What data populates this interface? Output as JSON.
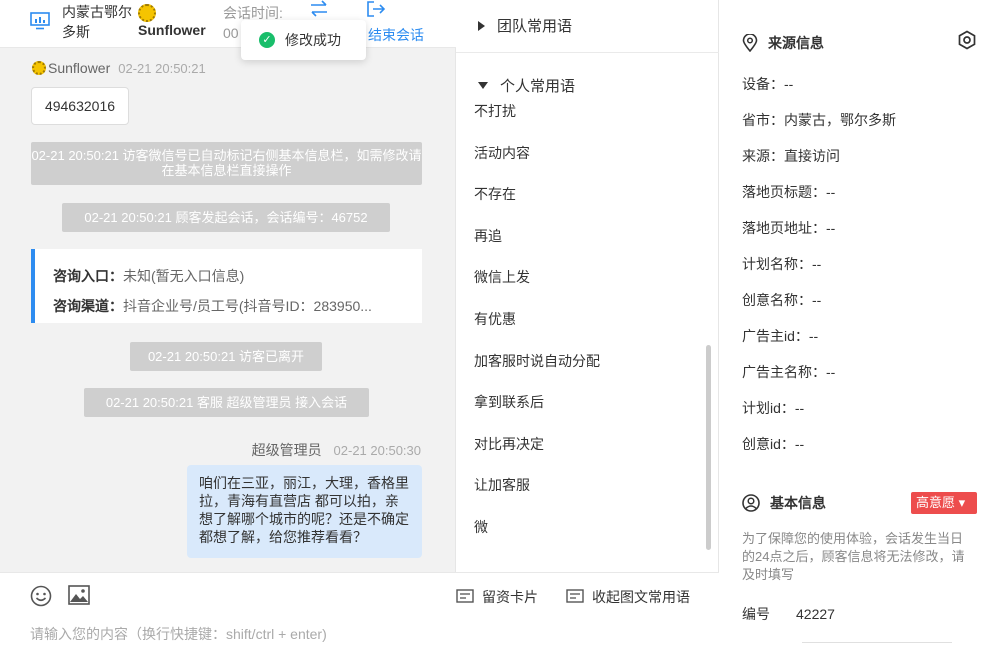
{
  "header": {
    "location": "内蒙古鄂尔多斯",
    "visitor_name": "Sunflower",
    "session_time_label": "会话时间:",
    "session_time_value": "00",
    "end_session_label": "结束会话",
    "transfer_icon": "transfer-arrows-icon",
    "end_icon": "exit-icon",
    "monitor_icon": "monitor-icon"
  },
  "toast": {
    "text": "修改成功",
    "icon": "check-circle-icon",
    "color": "#19be6b"
  },
  "chat": {
    "visitor_message": {
      "sender": "Sunflower",
      "time": "02-21 20:50:21",
      "text": "494632016"
    },
    "system_1": "02-21 20:50:21 访客微信号已自动标记右侧基本信息栏，如需修改请在基本信息栏直接操作",
    "system_2": "02-21 20:50:21 顾客发起会话，会话编号：46752",
    "info_card": {
      "entry_label": "咨询入口：",
      "entry_value": "未知(暂无入口信息)",
      "channel_label": "咨询渠道：",
      "channel_value": "抖音企业号/员工号(抖音号ID：283950..."
    },
    "system_3": "02-21 20:50:21 访客已离开",
    "system_4": "02-21 20:50:21 客服 超级管理员 接入会话",
    "agent_message": {
      "sender": "超级管理员",
      "time": "02-21 20:50:30",
      "text": "咱们在三亚，丽江，大理，香格里拉，青海有直营店 都可以拍，亲想了解哪个城市的呢？还是不确定都想了解，给您推荐看看？"
    }
  },
  "composer": {
    "placeholder": "请输入您的内容（换行快捷键：shift/ctrl + enter)",
    "card_button": "留资卡片",
    "phrase_button": "收起图文常用语",
    "emoji_icon": "smiley-icon",
    "image_icon": "image-icon"
  },
  "phrases": {
    "team_group": "团队常用语",
    "personal_group": "个人常用语",
    "items": [
      "不打扰",
      "活动内容",
      "不存在",
      "再追",
      "微信上发",
      "有优惠",
      "加客服时说自动分配",
      "拿到联系后",
      "对比再决定",
      "让加客服",
      "微"
    ]
  },
  "source_info": {
    "title": "来源信息",
    "title_icon": "location-pin-icon",
    "settings_icon": "settings-icon",
    "fields": [
      "设备：--",
      "省市：内蒙古，鄂尔多斯",
      "来源：直接访问",
      "落地页标题：--",
      "落地页地址：--",
      "计划名称：--",
      "创意名称：--",
      "广告主id：--",
      "广告主名称：--",
      "计划id：--",
      "创意id：--"
    ]
  },
  "basic_info": {
    "title": "基本信息",
    "title_icon": "user-circle-icon",
    "intent_badge": "高意愿",
    "notice": "为了保障您的使用体验，会话发生当日的24点之后，顾客信息将无法修改，请及时填写",
    "id_label": "编号",
    "id_value": "42227"
  },
  "colors": {
    "accent": "#2d8cf0",
    "badge": "#ed4d4d",
    "agent_bubble": "#d9e9fb",
    "system": "#cfcfcf"
  }
}
